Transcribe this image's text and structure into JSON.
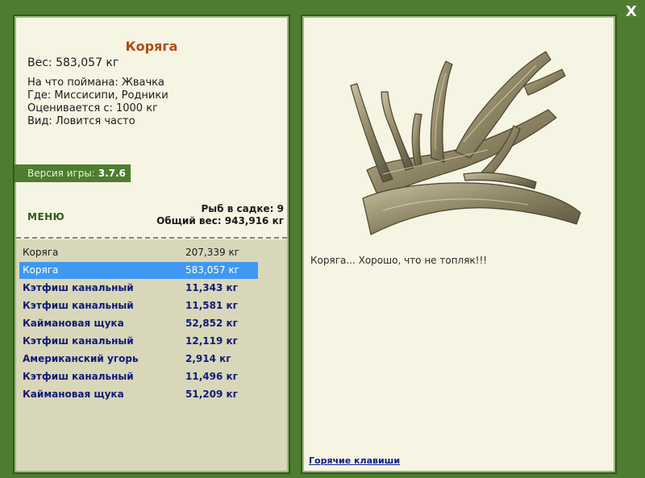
{
  "window": {
    "close_label": "X"
  },
  "fish": {
    "name": "Коряга",
    "weight_line": "Вес: 583,057 кг",
    "caught_on": "На что поймана: Жвачка",
    "location": "Где: Миссисипи, Родники",
    "valued_from": "Оценивается с: 1000 кг",
    "kind": "Вид: Ловится часто",
    "comment": "Коряга... Хорошо, что не топляк!!!"
  },
  "version": {
    "label": "Версия игры:",
    "number": "3.7.6"
  },
  "menu_label": "МЕНЮ",
  "stats": {
    "count_line": "Рыб в садке: 9",
    "total_line": "Общий вес: 943,916 кг"
  },
  "catch_list": [
    {
      "name": "Коряга",
      "weight": "207,339 кг",
      "style": "plain"
    },
    {
      "name": "Коряга",
      "weight": "583,057 кг",
      "style": "sel"
    },
    {
      "name": "Кэтфиш канальный",
      "weight": "11,343 кг",
      "style": "bold"
    },
    {
      "name": "Кэтфиш канальный",
      "weight": "11,581 кг",
      "style": "bold"
    },
    {
      "name": "Каймановая щука",
      "weight": "52,852 кг",
      "style": "bold"
    },
    {
      "name": "Кэтфиш канальный",
      "weight": "12,119 кг",
      "style": "bold"
    },
    {
      "name": "Американский угорь",
      "weight": "2,914 кг",
      "style": "bold"
    },
    {
      "name": "Кэтфиш канальный",
      "weight": "11,496 кг",
      "style": "bold"
    },
    {
      "name": "Каймановая щука",
      "weight": "51,209 кг",
      "style": "bold"
    }
  ],
  "hotkeys_label": "Горячие клавиши",
  "colors": {
    "frame_green": "#4e7d31",
    "panel_bg": "#f6f4e3",
    "list_bg": "#d9d7b9",
    "selected_row": "#3f98f3",
    "title": "#b14a12",
    "bold_name": "#0f1a78"
  },
  "icons": {
    "close": "close-icon"
  }
}
